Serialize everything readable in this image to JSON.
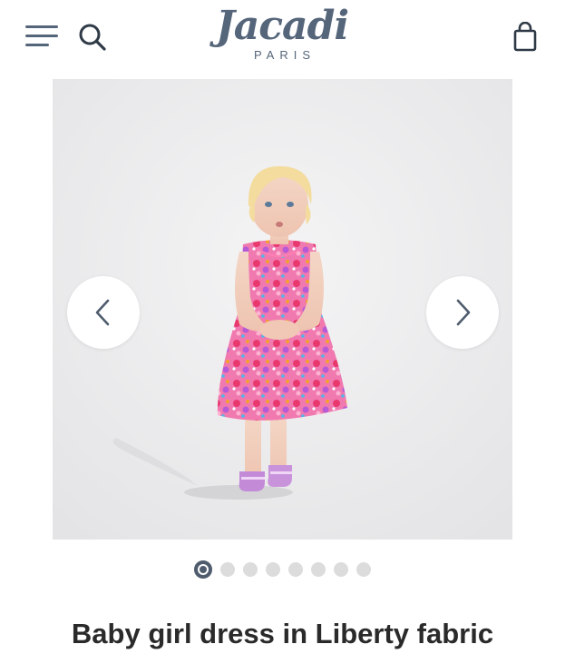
{
  "header": {
    "logo_word": "Jacadi",
    "logo_sub": "PARIS",
    "menu_icon": "hamburger-menu-icon",
    "search_icon": "search-icon",
    "bag_icon": "shopping-bag-icon"
  },
  "gallery": {
    "image_alt": "Baby girl dress in Liberty fabric",
    "prev_icon": "chevron-left-icon",
    "next_icon": "chevron-right-icon",
    "slide_count": 8,
    "active_slide": 1
  },
  "product": {
    "title": "Baby girl dress in Liberty fabric"
  },
  "colors": {
    "brand": "#55657a",
    "active_dot": "#4f5c6d",
    "inactive_dot": "#dcdcdc",
    "image_background": "#e9e9ea"
  }
}
